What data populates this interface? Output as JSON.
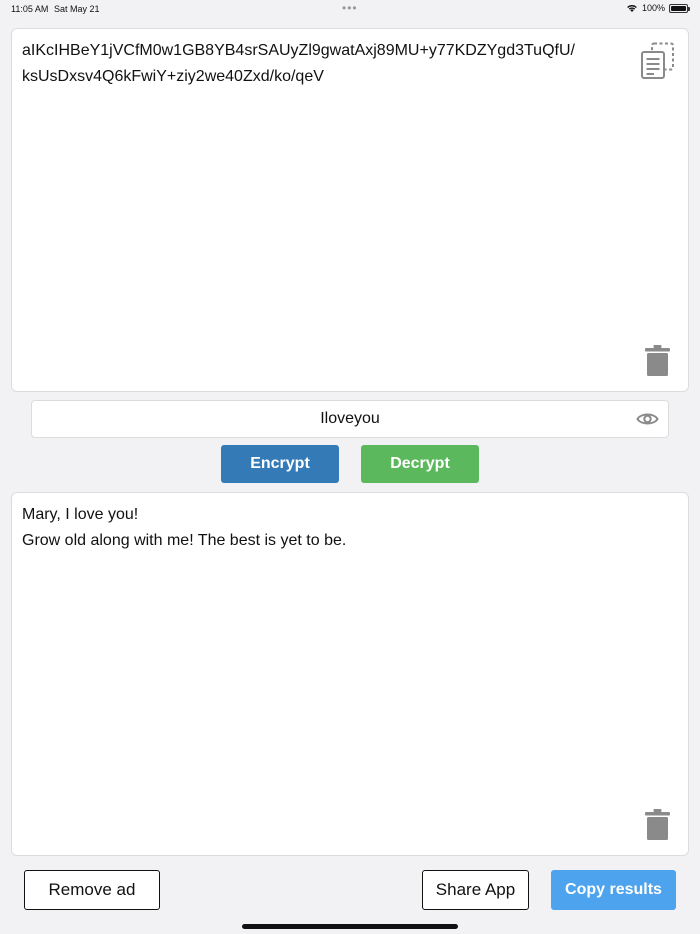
{
  "status_bar": {
    "time": "11:05 AM",
    "date": "Sat May 21",
    "battery": "100%",
    "battery_level": 1.0
  },
  "input_panel": {
    "text": "aIKcIHBeY1jVCfM0w1GB8YB4srSAUyZl9gwatAxj89MU+y77KDZYgd3TuQfU/\nksUsDxsv4Q6kFwiY+ziy2we40Zxd/ko/qeV",
    "copy_icon": "copy-icon",
    "clear_icon": "trash-icon"
  },
  "password": {
    "value": "Iloveyou",
    "toggle_icon": "eye-icon"
  },
  "actions": {
    "encrypt_label": "Encrypt",
    "decrypt_label": "Decrypt",
    "encrypt_color": "#337ab7",
    "decrypt_color": "#5cb85c"
  },
  "output_panel": {
    "text": "Mary, I love you!\nGrow old along with me! The best is yet to be.",
    "clear_icon": "trash-icon"
  },
  "bottom_bar": {
    "remove_ad_label": "Remove ad",
    "share_app_label": "Share App",
    "copy_results_label": "Copy results",
    "copy_results_color": "#4da3ee"
  }
}
